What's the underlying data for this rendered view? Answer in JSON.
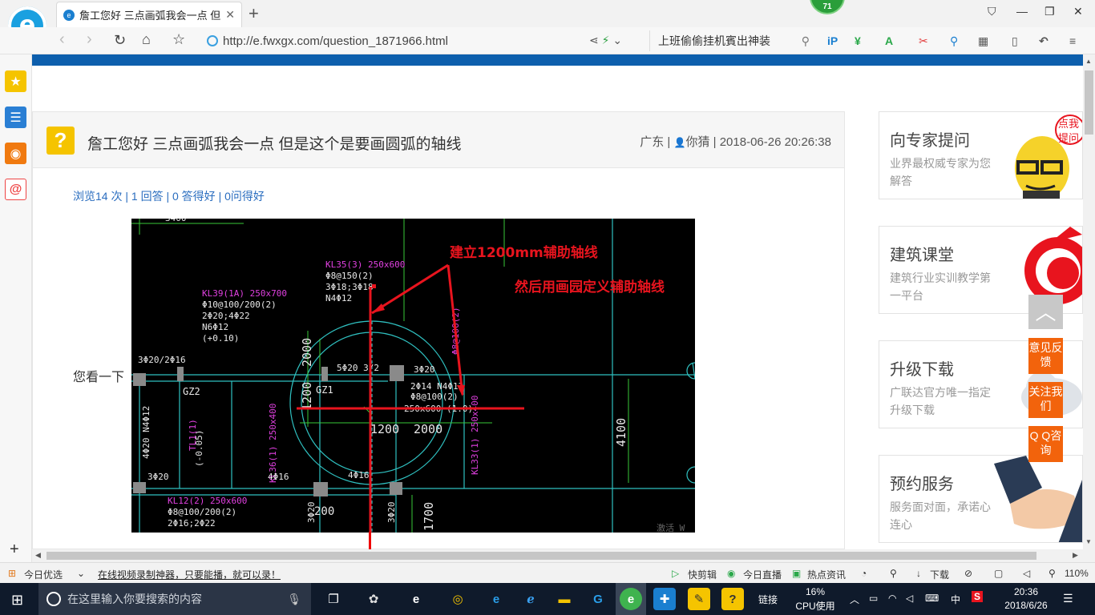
{
  "browser": {
    "tab_title": "詹工您好 三点画弧我会一点 但是",
    "tab_close": "✕",
    "new_tab": "+",
    "notification_badge": "71",
    "url": "http://e.fwxgx.com/question_1871966.html",
    "search_text": "上班偷偷挂机賓出神装"
  },
  "question": {
    "title": "詹工您好 三点画弧我会一点 但是这个是要画圆弧的轴线",
    "region": "广东",
    "user": "你猜",
    "datetime": "2018-06-26 20:26:38",
    "stats": {
      "views": "浏览14 次",
      "answers": "1 回答",
      "good_answers": "0 答得好",
      "good_questions": "0问得好"
    },
    "body_text": "您看一下"
  },
  "cad": {
    "annotation_1": "建立1200mm辅助轴线",
    "annotation_2": "然后用画园定义辅助轴线",
    "labels": {
      "kl35": "KL35(3) 250x600",
      "kl35_a": "Φ8@150(2)",
      "kl35_b": "3Φ18;3Φ18",
      "kl35_c": "N4Φ12",
      "kl39": "KL39(1A) 250x700",
      "kl39_a": "Φ10@100/200(2)",
      "kl39_b": "2Φ20;4Φ22",
      "kl39_c": "N6Φ12",
      "kl39_d": "(+0.10)",
      "dim_3400": "3400",
      "dim_2000_v": "2000",
      "dim_1200_v": "1200",
      "dim_1200": "1200",
      "dim_2000": "2000",
      "dim_4100": "4100",
      "dim_1700": "1700",
      "dim_200": "200",
      "gz2": "GZ2",
      "gz2b": "GZ1",
      "r_3020_16": "3Φ20/2Φ16",
      "r_5020": "5Φ20 3/2",
      "r_3020": "3Φ20",
      "r_2014": "2Φ14 N4Φ12",
      "r_8100": "Φ8@100(2)",
      "r_250": "250x600 (1.0)",
      "r_3020b": "3Φ20",
      "r_4016": "4Φ16",
      "r_4016b": "4Φ16",
      "r_3020c": "3Φ20",
      "r_3020d": "3Φ20",
      "tl1": "TL1(1)",
      "tl1b": "(-0.05)",
      "kl36": "KL36(1) 250x400",
      "kl33": "KL33(1) 250x400",
      "kl12": "KL12(2) 250x600",
      "kl12_a": "Φ8@100/200(2)",
      "kl12_b": "2Φ16;2Φ22",
      "left_col": "4Φ20 N4Φ12",
      "watermark": "激活 W"
    }
  },
  "sidebar": [
    {
      "title": "向专家提问",
      "sub": "业界最权威专家为您解答",
      "bubble": "点我提问"
    },
    {
      "title": "建筑课堂",
      "sub": "建筑行业实训教学第一平台"
    },
    {
      "title": "升级下载",
      "sub": "广联达官方唯一指定升级下载"
    },
    {
      "title": "预约服务",
      "sub": "服务面对面，承诺心连心"
    }
  ],
  "float_buttons": {
    "up": "︿",
    "feedback": "意见反馈",
    "follow": "关注我们",
    "qq": "Q Q咨询"
  },
  "statusbar": {
    "today": "今日优选",
    "promo": "在线视频录制神器，只要能播，就可以录！",
    "quick_clip": "快剪辑",
    "live": "今日直播",
    "news": "热点资讯",
    "download": "下载",
    "zoom": "110%"
  },
  "taskbar": {
    "search_placeholder": "在这里输入你要搜索的内容",
    "links": "链接",
    "cpu_pct": "16%",
    "cpu_label": "CPU使用",
    "ime": "中",
    "time": "20:36",
    "date": "2018/6/26"
  },
  "colors": {
    "brand_blue": "#0d5fad",
    "float_orange": "#f2630c",
    "link_blue": "#2a6dbf",
    "cad_red": "#e8141e",
    "cad_magenta": "#e040e0",
    "cad_cyan": "#2fc0c0",
    "cad_green": "#38c838"
  }
}
